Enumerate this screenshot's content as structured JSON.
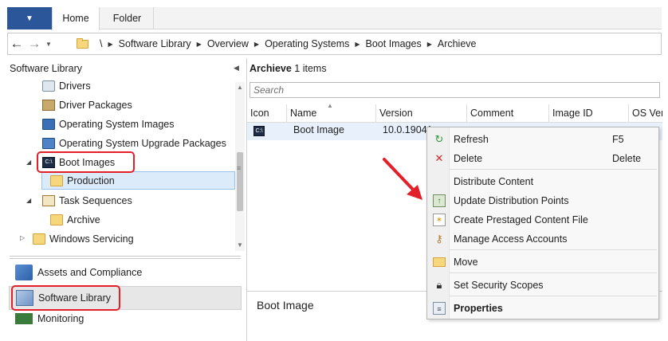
{
  "ribbon": {
    "file_label": "▼",
    "tabs": [
      "Home",
      "Folder"
    ]
  },
  "address": {
    "root": "\\",
    "crumbs": [
      "Software Library",
      "Overview",
      "Operating Systems",
      "Boot Images",
      "Archieve"
    ]
  },
  "left": {
    "header": "Software Library",
    "tree": [
      {
        "label": "Drivers",
        "icon": "driver-icon"
      },
      {
        "label": "Driver Packages",
        "icon": "driver-package-icon"
      },
      {
        "label": "Operating System Images",
        "icon": "os-image-icon"
      },
      {
        "label": "Operating System Upgrade Packages",
        "icon": "os-upgrade-package-icon"
      },
      {
        "label": "Boot Images",
        "icon": "boot-image-icon"
      },
      {
        "label": "Production",
        "icon": "folder-icon"
      },
      {
        "label": "Task Sequences",
        "icon": "task-sequence-icon"
      },
      {
        "label": "Archive",
        "icon": "folder-icon"
      },
      {
        "label": "Windows Servicing",
        "icon": "folder-icon"
      }
    ],
    "workspaces": [
      "Assets and Compliance",
      "Software Library",
      "Monitoring"
    ]
  },
  "right": {
    "title": "Archieve",
    "count": "1 items",
    "search_placeholder": "Search",
    "columns": [
      "Icon",
      "Name",
      "Version",
      "Comment",
      "Image ID",
      "OS Ver"
    ],
    "row": {
      "name": "Boot Image",
      "version": "10.0.19041"
    },
    "details_title": "Boot Image"
  },
  "context_menu": {
    "items": [
      {
        "label": "Refresh",
        "key": "F5",
        "icon": "refresh-icon"
      },
      {
        "label": "Delete",
        "key": "Delete",
        "icon": "delete-icon"
      },
      {
        "label": "Distribute Content",
        "icon": "distribute-content-icon"
      },
      {
        "label": "Update Distribution Points",
        "icon": "update-distribution-points-icon"
      },
      {
        "label": "Create Prestaged Content File",
        "icon": "prestaged-content-icon"
      },
      {
        "label": "Manage Access Accounts",
        "icon": "access-accounts-icon"
      },
      {
        "label": "Move",
        "icon": "move-icon"
      },
      {
        "label": "Set Security Scopes",
        "icon": "security-scopes-icon"
      },
      {
        "label": "Properties",
        "icon": "properties-icon"
      }
    ]
  },
  "colors": {
    "accent": "#2b579a",
    "highlight": "#e3202a",
    "selection": "#dcebfa"
  }
}
